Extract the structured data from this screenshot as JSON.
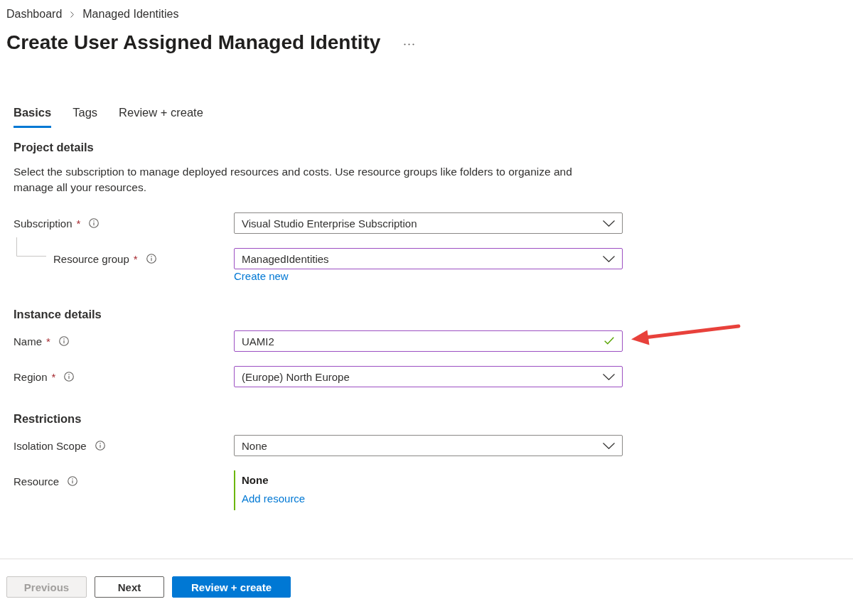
{
  "breadcrumb": [
    "Dashboard",
    "Managed Identities"
  ],
  "title": "Create User Assigned Managed Identity",
  "tabs": [
    {
      "label": "Basics",
      "selected": true
    },
    {
      "label": "Tags",
      "selected": false
    },
    {
      "label": "Review + create",
      "selected": false
    }
  ],
  "sections": [
    {
      "heading": "Project details",
      "description": "Select the subscription to manage deployed resources and costs. Use resource groups like folders to organize and manage all your resources.",
      "fields": [
        {
          "kind": "dropdown",
          "label": "Subscription",
          "required_mark": "*",
          "value": "Visual Studio Enterprise Subscription",
          "modified": false,
          "pointed_at": false,
          "children": [
            {
              "kind": "dropdown",
              "label": "Resource group",
              "required_mark": "*",
              "value": "ManagedIdentities",
              "modified": true,
              "pointed_at": false,
              "link": "Create new"
            }
          ]
        }
      ]
    },
    {
      "heading": "Instance details",
      "fields": [
        {
          "kind": "text",
          "label": "Name",
          "required_mark": "*",
          "value": "UAMI2",
          "modified": true,
          "valid": true,
          "pointed_at": true
        },
        {
          "kind": "dropdown",
          "label": "Region",
          "required_mark": "*",
          "value": "(Europe) North Europe",
          "modified": true,
          "pointed_at": false
        }
      ]
    },
    {
      "heading": "Restrictions",
      "fields": [
        {
          "kind": "dropdown",
          "label": "Isolation Scope",
          "value": "None",
          "modified": false,
          "pointed_at": false
        },
        {
          "kind": "resource",
          "label": "Resource",
          "value": "None",
          "link": "Add resource",
          "pointed_at": false
        }
      ]
    }
  ],
  "footer_buttons": [
    {
      "label": "Previous",
      "kind": "default",
      "disabled": true
    },
    {
      "label": "Next",
      "kind": "default",
      "disabled": false
    },
    {
      "label": "Review + create",
      "kind": "primary",
      "disabled": false
    }
  ]
}
